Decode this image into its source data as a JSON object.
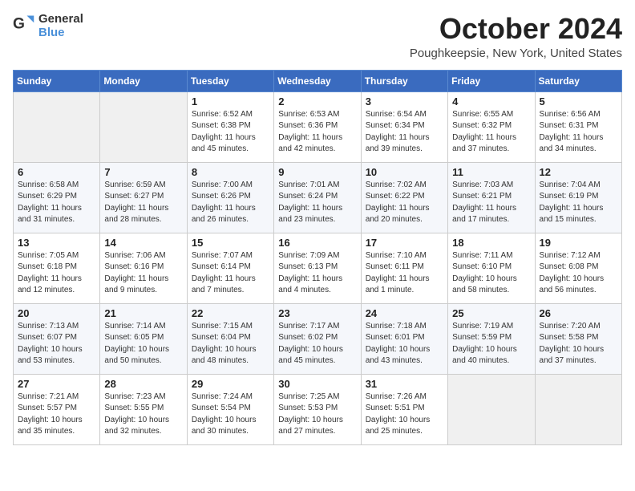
{
  "header": {
    "logo_general": "General",
    "logo_blue": "Blue",
    "month": "October 2024",
    "location": "Poughkeepsie, New York, United States"
  },
  "days_of_week": [
    "Sunday",
    "Monday",
    "Tuesday",
    "Wednesday",
    "Thursday",
    "Friday",
    "Saturday"
  ],
  "weeks": [
    [
      {
        "day": "",
        "empty": true
      },
      {
        "day": "",
        "empty": true
      },
      {
        "day": "1",
        "sunrise": "Sunrise: 6:52 AM",
        "sunset": "Sunset: 6:38 PM",
        "daylight": "Daylight: 11 hours and 45 minutes."
      },
      {
        "day": "2",
        "sunrise": "Sunrise: 6:53 AM",
        "sunset": "Sunset: 6:36 PM",
        "daylight": "Daylight: 11 hours and 42 minutes."
      },
      {
        "day": "3",
        "sunrise": "Sunrise: 6:54 AM",
        "sunset": "Sunset: 6:34 PM",
        "daylight": "Daylight: 11 hours and 39 minutes."
      },
      {
        "day": "4",
        "sunrise": "Sunrise: 6:55 AM",
        "sunset": "Sunset: 6:32 PM",
        "daylight": "Daylight: 11 hours and 37 minutes."
      },
      {
        "day": "5",
        "sunrise": "Sunrise: 6:56 AM",
        "sunset": "Sunset: 6:31 PM",
        "daylight": "Daylight: 11 hours and 34 minutes."
      }
    ],
    [
      {
        "day": "6",
        "sunrise": "Sunrise: 6:58 AM",
        "sunset": "Sunset: 6:29 PM",
        "daylight": "Daylight: 11 hours and 31 minutes."
      },
      {
        "day": "7",
        "sunrise": "Sunrise: 6:59 AM",
        "sunset": "Sunset: 6:27 PM",
        "daylight": "Daylight: 11 hours and 28 minutes."
      },
      {
        "day": "8",
        "sunrise": "Sunrise: 7:00 AM",
        "sunset": "Sunset: 6:26 PM",
        "daylight": "Daylight: 11 hours and 26 minutes."
      },
      {
        "day": "9",
        "sunrise": "Sunrise: 7:01 AM",
        "sunset": "Sunset: 6:24 PM",
        "daylight": "Daylight: 11 hours and 23 minutes."
      },
      {
        "day": "10",
        "sunrise": "Sunrise: 7:02 AM",
        "sunset": "Sunset: 6:22 PM",
        "daylight": "Daylight: 11 hours and 20 minutes."
      },
      {
        "day": "11",
        "sunrise": "Sunrise: 7:03 AM",
        "sunset": "Sunset: 6:21 PM",
        "daylight": "Daylight: 11 hours and 17 minutes."
      },
      {
        "day": "12",
        "sunrise": "Sunrise: 7:04 AM",
        "sunset": "Sunset: 6:19 PM",
        "daylight": "Daylight: 11 hours and 15 minutes."
      }
    ],
    [
      {
        "day": "13",
        "sunrise": "Sunrise: 7:05 AM",
        "sunset": "Sunset: 6:18 PM",
        "daylight": "Daylight: 11 hours and 12 minutes."
      },
      {
        "day": "14",
        "sunrise": "Sunrise: 7:06 AM",
        "sunset": "Sunset: 6:16 PM",
        "daylight": "Daylight: 11 hours and 9 minutes."
      },
      {
        "day": "15",
        "sunrise": "Sunrise: 7:07 AM",
        "sunset": "Sunset: 6:14 PM",
        "daylight": "Daylight: 11 hours and 7 minutes."
      },
      {
        "day": "16",
        "sunrise": "Sunrise: 7:09 AM",
        "sunset": "Sunset: 6:13 PM",
        "daylight": "Daylight: 11 hours and 4 minutes."
      },
      {
        "day": "17",
        "sunrise": "Sunrise: 7:10 AM",
        "sunset": "Sunset: 6:11 PM",
        "daylight": "Daylight: 11 hours and 1 minute."
      },
      {
        "day": "18",
        "sunrise": "Sunrise: 7:11 AM",
        "sunset": "Sunset: 6:10 PM",
        "daylight": "Daylight: 10 hours and 58 minutes."
      },
      {
        "day": "19",
        "sunrise": "Sunrise: 7:12 AM",
        "sunset": "Sunset: 6:08 PM",
        "daylight": "Daylight: 10 hours and 56 minutes."
      }
    ],
    [
      {
        "day": "20",
        "sunrise": "Sunrise: 7:13 AM",
        "sunset": "Sunset: 6:07 PM",
        "daylight": "Daylight: 10 hours and 53 minutes."
      },
      {
        "day": "21",
        "sunrise": "Sunrise: 7:14 AM",
        "sunset": "Sunset: 6:05 PM",
        "daylight": "Daylight: 10 hours and 50 minutes."
      },
      {
        "day": "22",
        "sunrise": "Sunrise: 7:15 AM",
        "sunset": "Sunset: 6:04 PM",
        "daylight": "Daylight: 10 hours and 48 minutes."
      },
      {
        "day": "23",
        "sunrise": "Sunrise: 7:17 AM",
        "sunset": "Sunset: 6:02 PM",
        "daylight": "Daylight: 10 hours and 45 minutes."
      },
      {
        "day": "24",
        "sunrise": "Sunrise: 7:18 AM",
        "sunset": "Sunset: 6:01 PM",
        "daylight": "Daylight: 10 hours and 43 minutes."
      },
      {
        "day": "25",
        "sunrise": "Sunrise: 7:19 AM",
        "sunset": "Sunset: 5:59 PM",
        "daylight": "Daylight: 10 hours and 40 minutes."
      },
      {
        "day": "26",
        "sunrise": "Sunrise: 7:20 AM",
        "sunset": "Sunset: 5:58 PM",
        "daylight": "Daylight: 10 hours and 37 minutes."
      }
    ],
    [
      {
        "day": "27",
        "sunrise": "Sunrise: 7:21 AM",
        "sunset": "Sunset: 5:57 PM",
        "daylight": "Daylight: 10 hours and 35 minutes."
      },
      {
        "day": "28",
        "sunrise": "Sunrise: 7:23 AM",
        "sunset": "Sunset: 5:55 PM",
        "daylight": "Daylight: 10 hours and 32 minutes."
      },
      {
        "day": "29",
        "sunrise": "Sunrise: 7:24 AM",
        "sunset": "Sunset: 5:54 PM",
        "daylight": "Daylight: 10 hours and 30 minutes."
      },
      {
        "day": "30",
        "sunrise": "Sunrise: 7:25 AM",
        "sunset": "Sunset: 5:53 PM",
        "daylight": "Daylight: 10 hours and 27 minutes."
      },
      {
        "day": "31",
        "sunrise": "Sunrise: 7:26 AM",
        "sunset": "Sunset: 5:51 PM",
        "daylight": "Daylight: 10 hours and 25 minutes."
      },
      {
        "day": "",
        "empty": true
      },
      {
        "day": "",
        "empty": true
      }
    ]
  ]
}
